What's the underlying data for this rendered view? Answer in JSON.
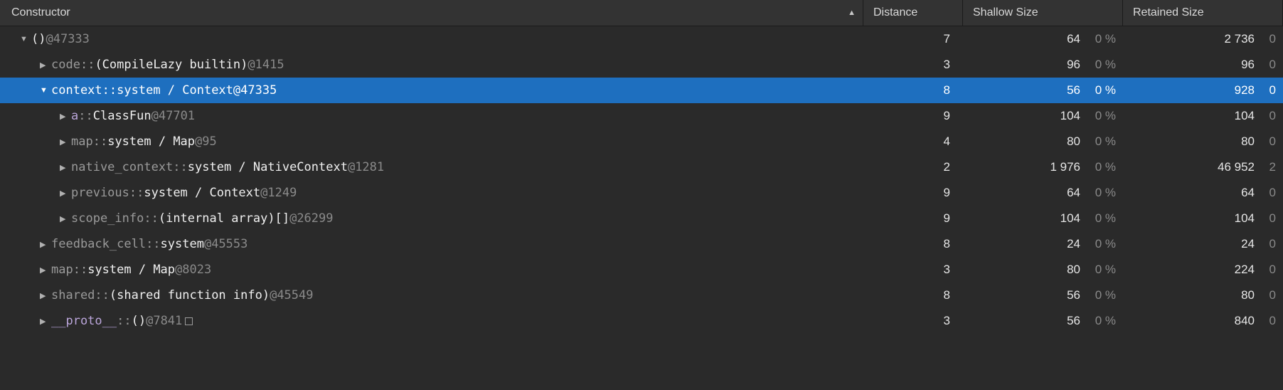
{
  "columns": {
    "constructor": "Constructor",
    "distance": "Distance",
    "shallow": "Shallow Size",
    "retained": "Retained Size"
  },
  "pct_label": "0 %",
  "rows": [
    {
      "indent": 28,
      "arrow": "down",
      "parts": [
        {
          "t": "()",
          "cls": "bright mono"
        },
        {
          "t": " @47333",
          "cls": "id mono"
        }
      ],
      "distance": "7",
      "shallow": "64",
      "retained": "2 736",
      "retained_pct_trunc": "0 "
    },
    {
      "indent": 56,
      "arrow": "right",
      "parts": [
        {
          "t": "code",
          "cls": "dim mono"
        },
        {
          "t": " :: ",
          "cls": "sep mono"
        },
        {
          "t": "(CompileLazy builtin)",
          "cls": "bright mono"
        },
        {
          "t": " @1415",
          "cls": "id mono"
        }
      ],
      "distance": "3",
      "shallow": "96",
      "retained": "96",
      "retained_pct_trunc": "0 "
    },
    {
      "indent": 56,
      "arrow": "down",
      "selected": true,
      "parts": [
        {
          "t": "context",
          "cls": "dim mono"
        },
        {
          "t": " :: ",
          "cls": "sep mono"
        },
        {
          "t": "system / Context",
          "cls": "bright mono"
        },
        {
          "t": " @47335",
          "cls": "id mono"
        }
      ],
      "distance": "8",
      "shallow": "56",
      "shallow_pct": "0 %",
      "retained": "928",
      "retained_pct_trunc": "0 "
    },
    {
      "indent": 84,
      "arrow": "right",
      "parts": [
        {
          "t": "a",
          "cls": "purple mono"
        },
        {
          "t": " :: ",
          "cls": "sep mono"
        },
        {
          "t": "ClassFun",
          "cls": "bright mono"
        },
        {
          "t": " @47701",
          "cls": "id mono"
        }
      ],
      "distance": "9",
      "shallow": "104",
      "retained": "104",
      "retained_pct_trunc": "0 "
    },
    {
      "indent": 84,
      "arrow": "right",
      "parts": [
        {
          "t": "map",
          "cls": "dim mono"
        },
        {
          "t": " :: ",
          "cls": "sep mono"
        },
        {
          "t": "system / Map",
          "cls": "bright mono"
        },
        {
          "t": " @95",
          "cls": "id mono"
        }
      ],
      "distance": "4",
      "shallow": "80",
      "retained": "80",
      "retained_pct_trunc": "0 "
    },
    {
      "indent": 84,
      "arrow": "right",
      "parts": [
        {
          "t": "native_context",
          "cls": "dim mono"
        },
        {
          "t": " :: ",
          "cls": "sep mono"
        },
        {
          "t": "system / NativeContext",
          "cls": "bright mono"
        },
        {
          "t": " @1281",
          "cls": "id mono"
        }
      ],
      "distance": "2",
      "shallow": "1 976",
      "retained": "46 952",
      "retained_pct_trunc": "2 "
    },
    {
      "indent": 84,
      "arrow": "right",
      "parts": [
        {
          "t": "previous",
          "cls": "dim mono"
        },
        {
          "t": " :: ",
          "cls": "sep mono"
        },
        {
          "t": "system / Context",
          "cls": "bright mono"
        },
        {
          "t": " @1249",
          "cls": "id mono"
        }
      ],
      "distance": "9",
      "shallow": "64",
      "retained": "64",
      "retained_pct_trunc": "0 "
    },
    {
      "indent": 84,
      "arrow": "right",
      "parts": [
        {
          "t": "scope_info",
          "cls": "dim mono"
        },
        {
          "t": " :: ",
          "cls": "sep mono"
        },
        {
          "t": "(internal array)[]",
          "cls": "bright mono"
        },
        {
          "t": " @26299",
          "cls": "id mono"
        }
      ],
      "distance": "9",
      "shallow": "104",
      "retained": "104",
      "retained_pct_trunc": "0 "
    },
    {
      "indent": 56,
      "arrow": "right",
      "parts": [
        {
          "t": "feedback_cell",
          "cls": "dim mono"
        },
        {
          "t": " :: ",
          "cls": "sep mono"
        },
        {
          "t": "system",
          "cls": "bright mono"
        },
        {
          "t": " @45553",
          "cls": "id mono"
        }
      ],
      "distance": "8",
      "shallow": "24",
      "retained": "24",
      "retained_pct_trunc": "0 "
    },
    {
      "indent": 56,
      "arrow": "right",
      "parts": [
        {
          "t": "map",
          "cls": "dim mono"
        },
        {
          "t": " :: ",
          "cls": "sep mono"
        },
        {
          "t": "system / Map",
          "cls": "bright mono"
        },
        {
          "t": " @8023",
          "cls": "id mono"
        }
      ],
      "distance": "3",
      "shallow": "80",
      "retained": "224",
      "retained_pct_trunc": "0 "
    },
    {
      "indent": 56,
      "arrow": "right",
      "parts": [
        {
          "t": "shared",
          "cls": "dim mono"
        },
        {
          "t": " :: ",
          "cls": "sep mono"
        },
        {
          "t": "(shared function info)",
          "cls": "bright mono"
        },
        {
          "t": " @45549",
          "cls": "id mono"
        }
      ],
      "distance": "8",
      "shallow": "56",
      "retained": "80",
      "retained_pct_trunc": "0 "
    },
    {
      "indent": 56,
      "arrow": "right",
      "parts": [
        {
          "t": "__proto__",
          "cls": "purple mono"
        },
        {
          "t": " :: ",
          "cls": "sep mono"
        },
        {
          "t": "()",
          "cls": "bright mono"
        },
        {
          "t": " @7841",
          "cls": "id mono"
        }
      ],
      "trailing_box": true,
      "distance": "3",
      "shallow": "56",
      "retained": "840",
      "retained_pct_trunc": "0 "
    }
  ]
}
